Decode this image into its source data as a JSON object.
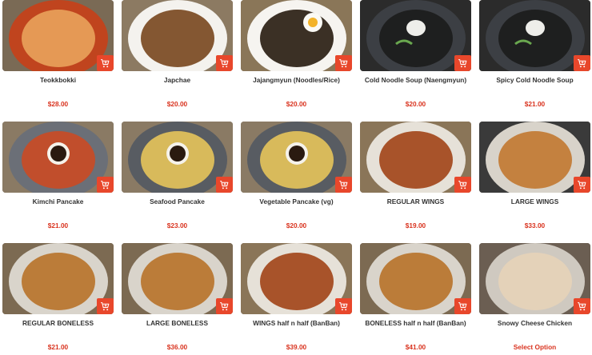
{
  "accent_color": "#e8472b",
  "price_color": "#d9331f",
  "cart_icon": "add-to-cart-icon",
  "items": [
    {
      "name": "Teokkbokki",
      "price": "$28.00",
      "dish": "tteokbokki"
    },
    {
      "name": "Japchae",
      "price": "$20.00",
      "dish": "noodles-plate"
    },
    {
      "name": "Jajangmyun (Noodles/Rice)",
      "price": "$20.00",
      "dish": "black-noodles"
    },
    {
      "name": "Cold Noodle Soup (Naengmyun)",
      "price": "$20.00",
      "dish": "cold-noodle"
    },
    {
      "name": "Spicy Cold Noodle Soup",
      "price": "$21.00",
      "dish": "cold-noodle"
    },
    {
      "name": "Kimchi Pancake",
      "price": "$21.00",
      "dish": "kimchi-pancake"
    },
    {
      "name": "Seafood Pancake",
      "price": "$23.00",
      "dish": "veg-pancake"
    },
    {
      "name": "Vegetable Pancake (vg)",
      "price": "$20.00",
      "dish": "veg-pancake"
    },
    {
      "name": "REGULAR WINGS",
      "price": "$19.00",
      "dish": "wings"
    },
    {
      "name": "LARGE WINGS",
      "price": "$33.00",
      "dish": "fried-chicken"
    },
    {
      "name": "REGULAR BONELESS",
      "price": "$21.00",
      "dish": "boneless"
    },
    {
      "name": "LARGE BONELESS",
      "price": "$36.00",
      "dish": "boneless"
    },
    {
      "name": "WINGS half n half (BanBan)",
      "price": "$39.00",
      "dish": "wings"
    },
    {
      "name": "BONELESS half n half (BanBan)",
      "price": "$41.00",
      "dish": "boneless"
    },
    {
      "name": "Snowy Cheese Chicken",
      "price": "Select Option",
      "dish": "cheese-chicken"
    }
  ]
}
